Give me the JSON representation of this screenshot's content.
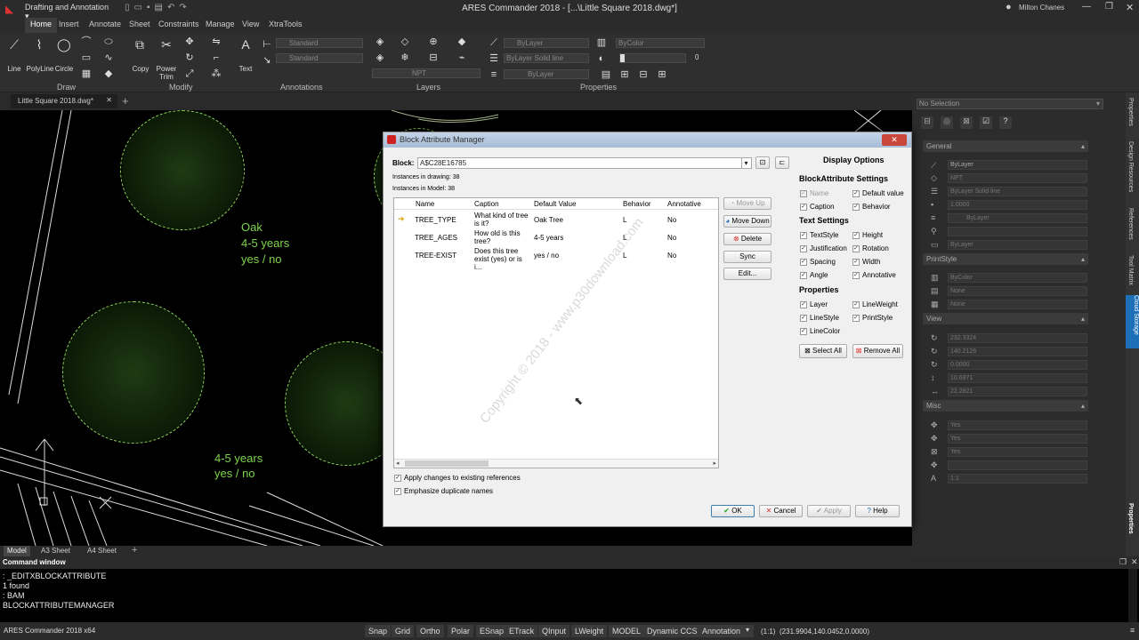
{
  "titlebar": {
    "workspace": "Drafting and Annotation",
    "title": "ARES Commander 2018 - [...\\Little Square 2018.dwg*]",
    "user": "Milton Chanes"
  },
  "menu": [
    "Home",
    "Insert",
    "Annotate",
    "Sheet",
    "Constraints",
    "Manage",
    "View",
    "XtraTools"
  ],
  "ribbon": {
    "draw_tools": [
      "Line",
      "PolyLine",
      "Circle"
    ],
    "modify_tools": [
      "Copy",
      "Power Trim"
    ],
    "text_tool": "Text",
    "groups": [
      "Draw",
      "Modify",
      "Annotations",
      "Layers",
      "Properties"
    ],
    "annot_style1": "Standard",
    "annot_style2": "Standard",
    "layer_current": "NPT",
    "prop_color": "ByLayer",
    "prop_linetype": "ByLayer",
    "prop_linetype_style": "Solid line",
    "prop_lineweight": "ByLayer",
    "prop_printstyle": "ByColor",
    "prop_transparency": "0"
  },
  "doctab": "Little Square 2018.dwg*",
  "canvas_labels": {
    "a1": "Oak",
    "a2": "4-5 years",
    "a3": "yes / no",
    "b1": "4-5 years",
    "b2": "yes / no"
  },
  "layout_tabs": [
    "Model",
    "A3 Sheet",
    "A4 Sheet"
  ],
  "command": {
    "header": "Command window",
    "lines": [
      ": _EDITXBLOCKATTRIBUTE",
      "1 found",
      ": BAM",
      "BLOCKATTRIBUTEMANAGER"
    ]
  },
  "status": {
    "app": "ARES Commander 2018 x64",
    "buttons": [
      "Snap",
      "Grid",
      "Ortho",
      "Polar",
      "ESnap",
      "ETrack",
      "QInput",
      "LWeight",
      "MODEL",
      "Dynamic CCS",
      "Annotation"
    ],
    "scale": "(1:1)",
    "coords": "(231.9904,140.0452,0.0000)"
  },
  "dialog": {
    "title": "Block Attribute Manager",
    "block_label": "Block:",
    "block_value": "A$C28E16785",
    "instances_drawing": "Instances in drawing: 38",
    "instances_model": "Instances in Model: 38",
    "columns": [
      "Name",
      "Caption",
      "Default Value",
      "Behavior",
      "Annotative"
    ],
    "rows": [
      {
        "name": "TREE_TYPE",
        "caption": "What kind of tree is it?",
        "default": "Oak Tree",
        "behavior": "L",
        "annotative": "No"
      },
      {
        "name": "TREE_AGES",
        "caption": "How old is this tree?",
        "default": "4-5 years",
        "behavior": "L",
        "annotative": "No"
      },
      {
        "name": "TREE-EXIST",
        "caption": "Does this tree exist (yes) or is i...",
        "default": "yes / no",
        "behavior": "L",
        "annotative": "No"
      }
    ],
    "buttons": {
      "move_up": "Move Up",
      "move_down": "Move Down",
      "delete": "Delete",
      "sync": "Sync",
      "edit": "Edit...",
      "ok": "OK",
      "cancel": "Cancel",
      "apply": "Apply",
      "help": "Help",
      "select_all": "Select All",
      "remove_all": "Remove All"
    },
    "apply_changes": "Apply changes to existing references",
    "emphasize": "Emphasize duplicate names",
    "display_options": "Display Options",
    "bas_title": "BlockAttribute Settings",
    "bas": [
      "Name",
      "Default value",
      "Caption",
      "Behavior"
    ],
    "ts_title": "Text Settings",
    "ts": [
      "TextStyle",
      "Height",
      "Justification",
      "Rotation",
      "Spacing",
      "Width",
      "Angle",
      "Annotative"
    ],
    "pr_title": "Properties",
    "pr": [
      "Layer",
      "LineWeight",
      "LineStyle",
      "PrintStyle",
      "LineColor"
    ],
    "watermark": "Copyright © 2018 - www.p30download.com"
  },
  "props_panel": {
    "selection": "No Selection",
    "general": "General",
    "gen_rows": [
      "ByLayer",
      "NPT",
      "ByLayer     Solid line",
      "1.0000",
      "ByLayer",
      "",
      "ByLayer"
    ],
    "printstyle": "PrintStyle",
    "ps_rows": [
      "ByColor",
      "None",
      "None"
    ],
    "view": "View",
    "view_rows": [
      "232.3324",
      "140.2126",
      "0.0000",
      "10.6971",
      "22.2821"
    ],
    "misc": "Misc",
    "misc_rows": [
      "Yes",
      "Yes",
      "Yes",
      "",
      "1:1"
    ]
  },
  "side_tabs": [
    "Properties",
    "Design Resources",
    "References",
    "Tool Matrix",
    "Cloud Storage",
    "Properties"
  ]
}
